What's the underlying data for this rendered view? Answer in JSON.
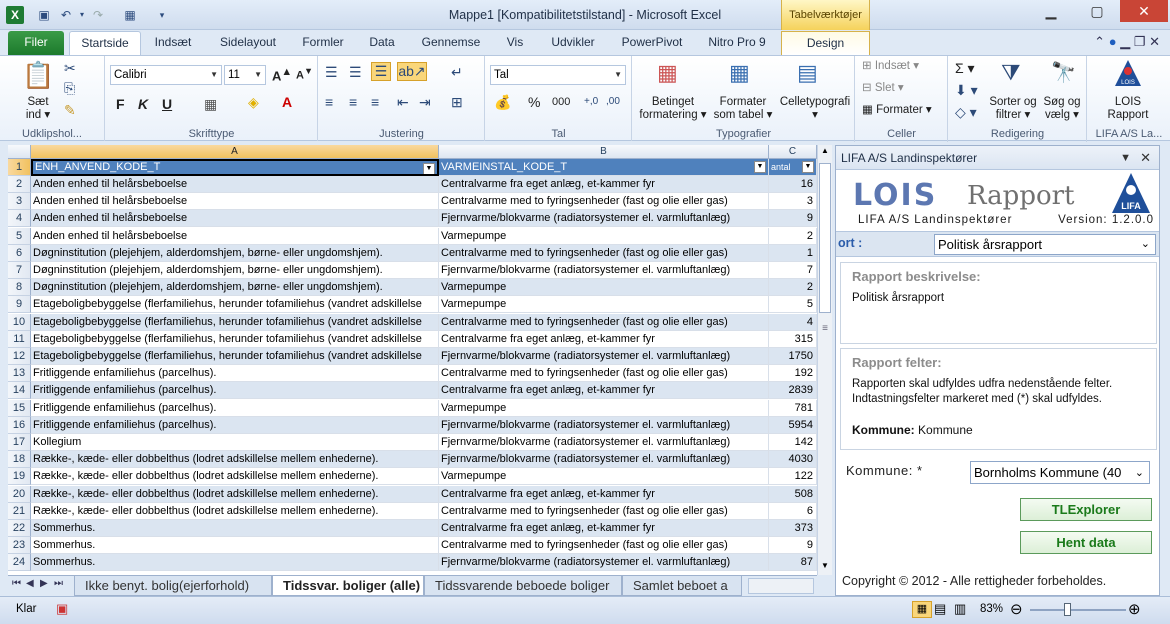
{
  "window": {
    "title": "Mappe1  [Kompatibilitetstilstand]  -  Microsoft Excel",
    "contextual_tab": "Tabelværktøjer"
  },
  "tabs": {
    "file": "Filer",
    "items": [
      "Startside",
      "Indsæt",
      "Sidelayout",
      "Formler",
      "Data",
      "Gennemse",
      "Vis",
      "Udvikler",
      "PowerPivot",
      "Nitro Pro 9",
      "Design"
    ]
  },
  "ribbon": {
    "clipboard": {
      "paste": "Sæt",
      "paste2": "ind",
      "label": "Udklipshol..."
    },
    "font": {
      "name": "Calibri",
      "size": "11",
      "label": "Skrifttype",
      "bold": "F",
      "italic": "K",
      "underline": "U"
    },
    "alignment": {
      "label": "Justering"
    },
    "number": {
      "format": "Tal",
      "percent": "%",
      "thousands": "000",
      "label": "Tal"
    },
    "styles": {
      "cond1": "Betinget",
      "cond2": "formatering",
      "table1": "Formater",
      "table2": "som tabel",
      "cell": "Celletypografi",
      "label": "Typografier"
    },
    "cells": {
      "insert": "Indsæt",
      "delete": "Slet",
      "format": "Formater",
      "label": "Celler"
    },
    "editing": {
      "sort1": "Sorter og",
      "sort2": "filtrer",
      "find1": "Søg og",
      "find2": "vælg",
      "label": "Redigering"
    },
    "lois": {
      "btn1": "LOIS",
      "btn2": "Rapport",
      "label": "LIFA A/S La..."
    }
  },
  "grid": {
    "columns": [
      "A",
      "B",
      "C"
    ],
    "header": [
      "ENH_ANVEND_KODE_T",
      "VARMEINSTAL_KODE_T",
      "antal"
    ],
    "rows": [
      [
        "2",
        "Anden enhed til helårsbeboelse",
        "Centralvarme fra eget anlæg, et-kammer fyr",
        "16"
      ],
      [
        "3",
        "Anden enhed til helårsbeboelse",
        "Centralvarme med to fyringsenheder (fast og olie eller gas)",
        "3"
      ],
      [
        "4",
        "Anden enhed til helårsbeboelse",
        "Fjernvarme/blokvarme (radiatorsystemer el. varmluftanlæg)",
        "9"
      ],
      [
        "5",
        "Anden enhed til helårsbeboelse",
        "Varmepumpe",
        "2"
      ],
      [
        "6",
        "Døgninstitution (plejehjem, alderdomshjem, børne- eller ungdomshjem).",
        "Centralvarme med to fyringsenheder (fast og olie eller gas)",
        "1"
      ],
      [
        "7",
        "Døgninstitution (plejehjem, alderdomshjem, børne- eller ungdomshjem).",
        "Fjernvarme/blokvarme (radiatorsystemer el. varmluftanlæg)",
        "7"
      ],
      [
        "8",
        "Døgninstitution (plejehjem, alderdomshjem, børne- eller ungdomshjem).",
        "Varmepumpe",
        "2"
      ],
      [
        "9",
        "Etageboligbebyggelse (flerfamiliehus, herunder tofamiliehus (vandret adskillelse",
        "Varmepumpe",
        "5"
      ],
      [
        "10",
        "Etageboligbebyggelse (flerfamiliehus, herunder tofamiliehus (vandret adskillelse",
        "Centralvarme med to fyringsenheder (fast og olie eller gas)",
        "4"
      ],
      [
        "11",
        "Etageboligbebyggelse (flerfamiliehus, herunder tofamiliehus (vandret adskillelse",
        "Centralvarme fra eget anlæg, et-kammer fyr",
        "315"
      ],
      [
        "12",
        "Etageboligbebyggelse (flerfamiliehus, herunder tofamiliehus (vandret adskillelse",
        "Fjernvarme/blokvarme (radiatorsystemer el. varmluftanlæg)",
        "1750"
      ],
      [
        "13",
        "Fritliggende enfamiliehus (parcelhus).",
        "Centralvarme med to fyringsenheder (fast og olie eller gas)",
        "192"
      ],
      [
        "14",
        "Fritliggende enfamiliehus (parcelhus).",
        "Centralvarme fra eget anlæg, et-kammer fyr",
        "2839"
      ],
      [
        "15",
        "Fritliggende enfamiliehus (parcelhus).",
        "Varmepumpe",
        "781"
      ],
      [
        "16",
        "Fritliggende enfamiliehus (parcelhus).",
        "Fjernvarme/blokvarme (radiatorsystemer el. varmluftanlæg)",
        "5954"
      ],
      [
        "17",
        "Kollegium",
        "Fjernvarme/blokvarme (radiatorsystemer el. varmluftanlæg)",
        "142"
      ],
      [
        "18",
        "Række-, kæde- eller dobbelthus (lodret adskillelse mellem enhederne).",
        "Fjernvarme/blokvarme (radiatorsystemer el. varmluftanlæg)",
        "4030"
      ],
      [
        "19",
        "Række-, kæde- eller dobbelthus (lodret adskillelse mellem enhederne).",
        "Varmepumpe",
        "122"
      ],
      [
        "20",
        "Række-, kæde- eller dobbelthus (lodret adskillelse mellem enhederne).",
        "Centralvarme fra eget anlæg, et-kammer fyr",
        "508"
      ],
      [
        "21",
        "Række-, kæde- eller dobbelthus (lodret adskillelse mellem enhederne).",
        "Centralvarme med to fyringsenheder (fast og olie eller gas)",
        "6"
      ],
      [
        "22",
        "Sommerhus.",
        "Centralvarme fra eget anlæg, et-kammer fyr",
        "373"
      ],
      [
        "23",
        "Sommerhus.",
        "Centralvarme med to fyringsenheder (fast og olie eller gas)",
        "9"
      ],
      [
        "24",
        "Sommerhus.",
        "Fjernvarme/blokvarme (radiatorsystemer el. varmluftanlæg)",
        "87"
      ]
    ]
  },
  "sheets": [
    "Ikke benyt. bolig(ejerforhold)",
    "Tidssvar. boliger (alle)",
    "Tidssvarende beboede boliger",
    "Samlet beboet a"
  ],
  "status": {
    "ready": "Klar",
    "zoom": "83%"
  },
  "pane": {
    "title": "LIFA A/S Landinspektører",
    "logo_lois": "LOIS",
    "logo_rapport": "Rapport",
    "company": "LIFA A/S Landinspektører",
    "version": "Version: 1.2.0.0",
    "report_label": "ort :",
    "report_value": "Politisk årsrapport",
    "desc_title": "Rapport beskrivelse:",
    "desc_text": "Politisk årsrapport",
    "fields_title": "Rapport felter:",
    "fields_text1": "Rapporten skal udfyldes udfra nedenstående felter.",
    "fields_text2": "Indtastningsfelter markeret med (*) skal udfyldes.",
    "kommune_bold": "Kommune:",
    "kommune_val": "Kommune",
    "kommune_label": "Kommune: *",
    "kommune_select": "Bornholms Kommune (40",
    "btn_tlexplorer": "TLExplorer",
    "btn_hent": "Hent data",
    "copyright": "Copyright © 2012 - Alle rettigheder forbeholdes."
  }
}
